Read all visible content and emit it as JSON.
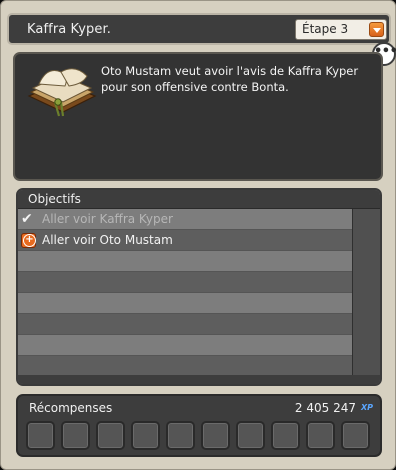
{
  "header": {
    "title": "Kaffra Kyper.",
    "step_label": "Étape 3"
  },
  "chat_icon": "ellipsis-bubble",
  "description": {
    "icon": "quest-book",
    "text": "Oto Mustam veut avoir l'avis de Kaffra Kyper pour son offensive contre Bonta."
  },
  "objectives": {
    "header": "Objectifs",
    "items": [
      {
        "label": "Aller voir Kaffra Kyper",
        "state": "done",
        "icon": "checkmark"
      },
      {
        "label": "Aller voir Oto Mustam",
        "state": "active",
        "icon": "orange-target"
      },
      {
        "label": "",
        "state": "empty"
      },
      {
        "label": "",
        "state": "empty"
      },
      {
        "label": "",
        "state": "empty"
      },
      {
        "label": "",
        "state": "empty"
      },
      {
        "label": "",
        "state": "empty"
      },
      {
        "label": "",
        "state": "empty"
      }
    ]
  },
  "rewards": {
    "label": "Récompenses",
    "xp_value": "2 405 247",
    "xp_unit": "XP",
    "slot_count": 10
  },
  "colors": {
    "accent_orange": "#e86a1f",
    "panel_dark": "#3d3d3d",
    "frame": "#d6d0c0"
  }
}
